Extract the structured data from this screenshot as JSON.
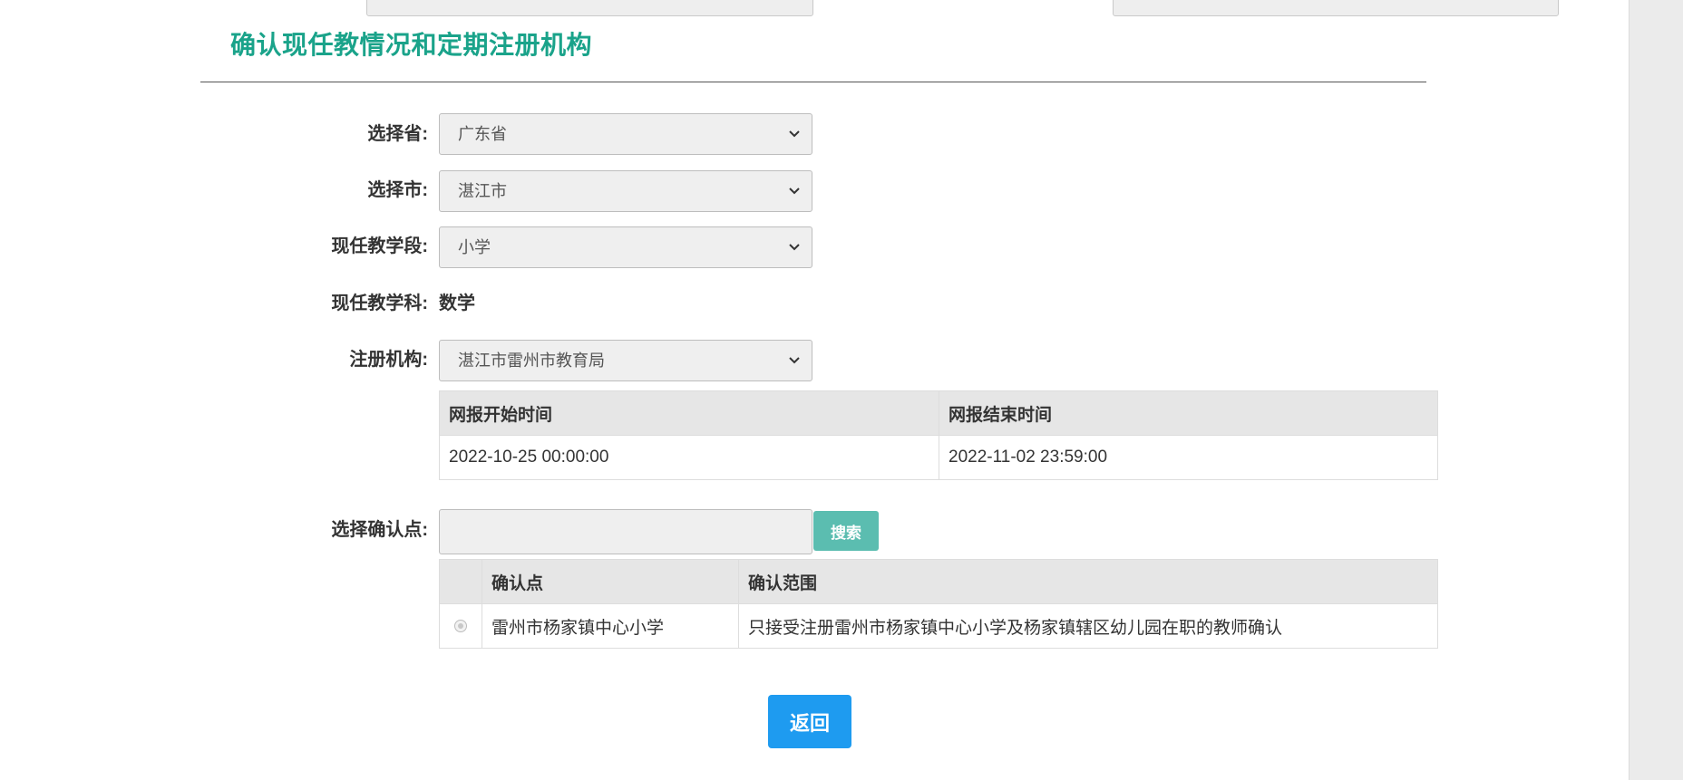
{
  "section": {
    "title": "确认现任教情况和定期注册机构"
  },
  "form": {
    "province": {
      "label": "选择省:",
      "value": "广东省"
    },
    "city": {
      "label": "选择市:",
      "value": "湛江市"
    },
    "stage": {
      "label": "现任教学段:",
      "value": "小学"
    },
    "subject": {
      "label": "现任教学科:",
      "value": "数学"
    },
    "agency": {
      "label": "注册机构:",
      "value": "湛江市雷州市教育局"
    }
  },
  "period_table": {
    "headers": [
      "网报开始时间",
      "网报结束时间"
    ],
    "rows": [
      [
        "2022-10-25 00:00:00",
        "2022-11-02 23:59:00"
      ]
    ]
  },
  "confirm_point": {
    "label": "选择确认点:",
    "search_value": "",
    "search_button": "搜索"
  },
  "points_table": {
    "headers": [
      "",
      "确认点",
      "确认范围"
    ],
    "rows": [
      [
        "",
        "雷州市杨家镇中心小学",
        "只接受注册雷州市杨家镇中心小学及杨家镇辖区幼儿园在职的教师确认"
      ]
    ]
  },
  "actions": {
    "back_label": "返回"
  },
  "colors": {
    "title": "#1aa38a",
    "search_button": "#5bbdb0",
    "back_button": "#1e9bf0"
  },
  "icons": {
    "select_arrow": "chevron-down-icon",
    "row_radio": "radio-icon"
  }
}
